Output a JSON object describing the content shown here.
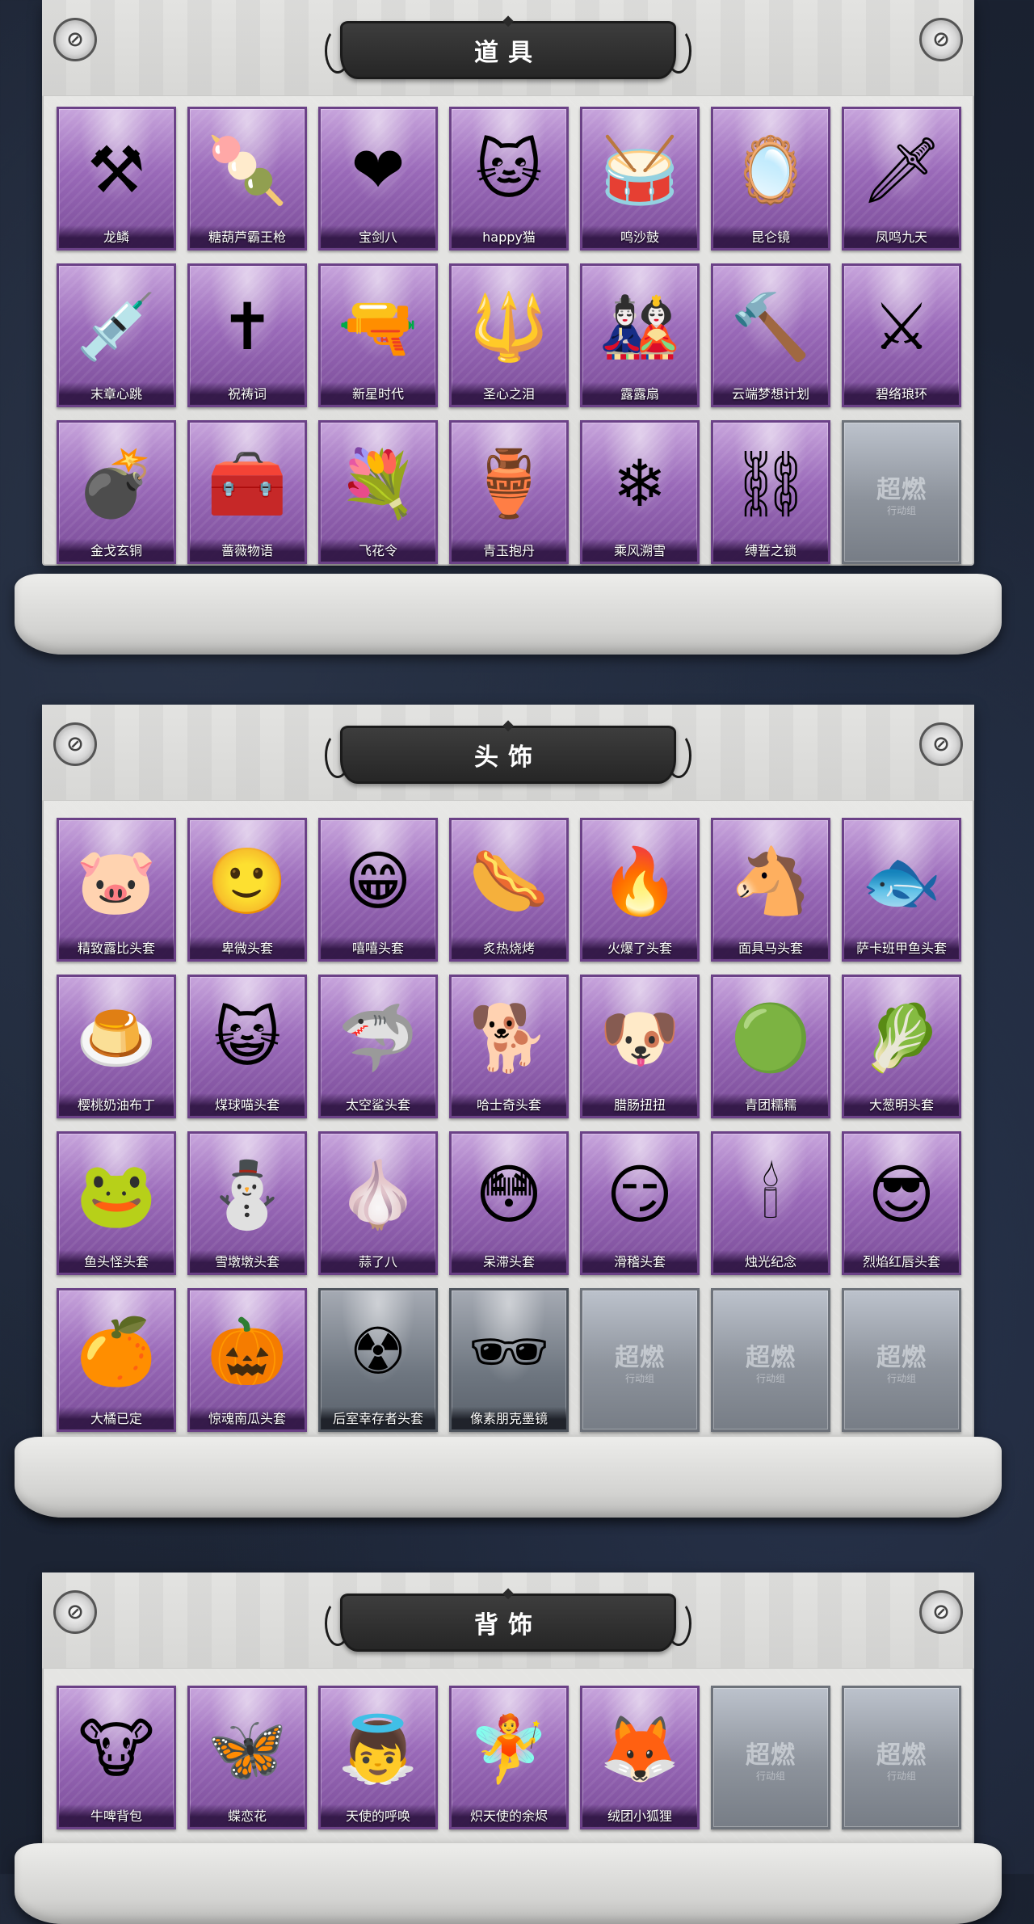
{
  "sections": [
    {
      "title": "道具",
      "items": [
        {
          "label": "龙鳞",
          "icon": "golden-shovel-icon",
          "glyph": "⚒"
        },
        {
          "label": "糖葫芦霸王枪",
          "icon": "candy-spear-icon",
          "glyph": "🍡"
        },
        {
          "label": "宝剑八",
          "icon": "heart-shield-icon",
          "glyph": "❤"
        },
        {
          "label": "happy猫",
          "icon": "cat-figure-icon",
          "glyph": "🐱"
        },
        {
          "label": "鸣沙鼓",
          "icon": "drum-charm-icon",
          "glyph": "🥁"
        },
        {
          "label": "昆仑镜",
          "icon": "mirror-icon",
          "glyph": "🪞"
        },
        {
          "label": "凤鸣九天",
          "icon": "red-blade-icon",
          "glyph": "🗡"
        },
        {
          "label": "末章心跳",
          "icon": "syringe-icon",
          "glyph": "💉"
        },
        {
          "label": "祝祷词",
          "icon": "cross-pendant-icon",
          "glyph": "✝"
        },
        {
          "label": "新星时代",
          "icon": "revolver-icon",
          "glyph": "🔫"
        },
        {
          "label": "圣心之泪",
          "icon": "ruby-scepter-icon",
          "glyph": "🔱"
        },
        {
          "label": "露露扇",
          "icon": "doll-fan-icon",
          "glyph": "🎎"
        },
        {
          "label": "云端梦想计划",
          "icon": "mace-icon",
          "glyph": "🔨"
        },
        {
          "label": "碧络琅环",
          "icon": "jade-sword-icon",
          "glyph": "⚔"
        },
        {
          "label": "金戈玄铜",
          "icon": "grenade-icon",
          "glyph": "💣"
        },
        {
          "label": "蔷薇物语",
          "icon": "medkit-icon",
          "glyph": "🧰"
        },
        {
          "label": "飞花令",
          "icon": "flower-bouquet-icon",
          "glyph": "💐"
        },
        {
          "label": "青玉抱丹",
          "icon": "vase-icon",
          "glyph": "🏺"
        },
        {
          "label": "乘风溯雪",
          "icon": "snow-device-icon",
          "glyph": "❄"
        },
        {
          "label": "缚誓之锁",
          "icon": "chain-scepter-icon",
          "glyph": "⛓"
        },
        {
          "empty": true,
          "watermark": "超燃",
          "watermark_sub": "行动组"
        }
      ]
    },
    {
      "title": "头饰",
      "items": [
        {
          "label": "精致露比头套",
          "icon": "pink-beaver-head-icon",
          "glyph": "🐷"
        },
        {
          "label": "卑微头套",
          "icon": "humble-emoji-icon",
          "glyph": "🙂"
        },
        {
          "label": "嘻嘻头套",
          "icon": "grin-emoji-icon",
          "glyph": "😁"
        },
        {
          "label": "炙热烧烤",
          "icon": "sausage-head-icon",
          "glyph": "🌭"
        },
        {
          "label": "火爆了头套",
          "icon": "flame-head-icon",
          "glyph": "🔥"
        },
        {
          "label": "面具马头套",
          "icon": "horse-head-icon",
          "glyph": "🐴"
        },
        {
          "label": "萨卡班甲鱼头套",
          "icon": "fish-head-icon",
          "glyph": "🐟"
        },
        {
          "label": "樱桃奶油布丁",
          "icon": "pudding-head-icon",
          "glyph": "🍮"
        },
        {
          "label": "煤球喵头套",
          "icon": "gray-cat-head-icon",
          "glyph": "😺"
        },
        {
          "label": "太空鲨头套",
          "icon": "shark-head-icon",
          "glyph": "🦈"
        },
        {
          "label": "哈士奇头套",
          "icon": "husky-head-icon",
          "glyph": "🐕"
        },
        {
          "label": "腊肠扭扭",
          "icon": "dachshund-head-icon",
          "glyph": "🐶"
        },
        {
          "label": "青团糯糯",
          "icon": "green-bun-head-icon",
          "glyph": "🟢"
        },
        {
          "label": "大葱明头套",
          "icon": "scallion-head-icon",
          "glyph": "🥬"
        },
        {
          "label": "鱼头怪头套",
          "icon": "fish-monster-head-icon",
          "glyph": "🐸"
        },
        {
          "label": "雪墩墩头套",
          "icon": "snowman-head-icon",
          "glyph": "⛄"
        },
        {
          "label": "蒜了八",
          "icon": "garlic-head-icon",
          "glyph": "🧄"
        },
        {
          "label": "呆滞头套",
          "icon": "dazed-emoji-icon",
          "glyph": "😳"
        },
        {
          "label": "滑稽头套",
          "icon": "sly-emoji-icon",
          "glyph": "😏"
        },
        {
          "label": "烛光纪念",
          "icon": "candle-head-icon",
          "glyph": "🕯"
        },
        {
          "label": "烈焰红唇头套",
          "icon": "pikachu-head-icon",
          "glyph": "😎"
        },
        {
          "label": "大橘已定",
          "icon": "orange-head-icon",
          "glyph": "🍊"
        },
        {
          "label": "惊魂南瓜头套",
          "icon": "pumpkin-head-icon",
          "glyph": "🎃"
        },
        {
          "label": "后室幸存者头套",
          "icon": "gas-mask-head-icon",
          "glyph": "☢",
          "variant": "blue"
        },
        {
          "label": "像素朋克墨镜",
          "icon": "pixel-sunglasses-icon",
          "glyph": "🕶",
          "variant": "blue"
        },
        {
          "empty": true,
          "watermark": "超燃",
          "watermark_sub": "行动组"
        },
        {
          "empty": true,
          "watermark": "超燃",
          "watermark_sub": "行动组"
        },
        {
          "empty": true,
          "watermark": "超燃",
          "watermark_sub": "行动组"
        }
      ]
    },
    {
      "title": "背饰",
      "items": [
        {
          "label": "牛啤背包",
          "icon": "cow-barrel-backpack-icon",
          "glyph": "🐮"
        },
        {
          "label": "蝶恋花",
          "icon": "butterfly-wreath-icon",
          "glyph": "🦋"
        },
        {
          "label": "天使的呼唤",
          "icon": "angel-doll-icon",
          "glyph": "👼"
        },
        {
          "label": "炽天使的余烬",
          "icon": "seraph-doll-icon",
          "glyph": "🧚"
        },
        {
          "label": "绒团小狐狸",
          "icon": "fox-doll-icon",
          "glyph": "🦊"
        },
        {
          "empty": true,
          "watermark": "超燃",
          "watermark_sub": "行动组"
        },
        {
          "empty": true,
          "watermark": "超燃",
          "watermark_sub": "行动组"
        }
      ]
    }
  ]
}
